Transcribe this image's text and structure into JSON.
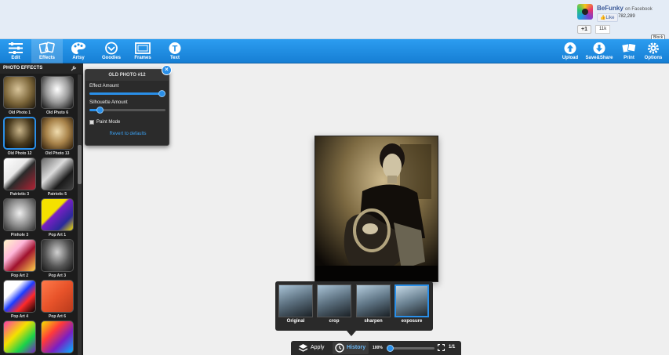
{
  "banner": {
    "brand": "BeFunky",
    "brand_sub": "on Facebook",
    "like_label": "Like",
    "like_count": "782,289",
    "gplus_label": "+1",
    "gplus_count": "11k",
    "block_tip": "Block"
  },
  "toolbar": {
    "left": [
      {
        "id": "edit",
        "label": "Edit",
        "icon": "sliders-icon"
      },
      {
        "id": "effects",
        "label": "Effects",
        "icon": "effects-icon",
        "active": true
      },
      {
        "id": "artsy",
        "label": "Artsy",
        "icon": "palette-icon"
      },
      {
        "id": "goodies",
        "label": "Goodies",
        "icon": "goodies-icon"
      },
      {
        "id": "frames",
        "label": "Frames",
        "icon": "frame-icon"
      },
      {
        "id": "text",
        "label": "Text",
        "icon": "text-icon"
      }
    ],
    "right": [
      {
        "id": "upload",
        "label": "Upload",
        "icon": "upload-icon"
      },
      {
        "id": "saveshare",
        "label": "Save&Share",
        "icon": "download-icon"
      },
      {
        "id": "print",
        "label": "Print",
        "icon": "print-icon"
      },
      {
        "id": "options",
        "label": "Options",
        "icon": "gear-icon"
      }
    ]
  },
  "sidebar": {
    "title": "PHOTO EFFECTS",
    "selected": "Old Photo 12",
    "thumbnails": [
      "Old Photo 1",
      "Old Photo 6",
      "Old Photo 12",
      "Old Photo 13",
      "Patriotic 3",
      "Patriotic 5",
      "Pinhole 3",
      "Pop Art 1",
      "Pop Art 2",
      "Pop Art 3",
      "Pop Art 4",
      "Pop Art 6",
      "",
      ""
    ]
  },
  "effect_panel": {
    "title": "OLD PHOTO #12",
    "effect_amount_label": "Effect Amount",
    "effect_amount": 0.95,
    "silhouette_label": "Silhouette Amount",
    "silhouette_amount": 0.13,
    "paint_mode_label": "Paint Mode",
    "paint_mode": false,
    "revert_label": "Revert to defaults",
    "close_label": "×"
  },
  "history": {
    "items": [
      {
        "label": "Original"
      },
      {
        "label": "crop"
      },
      {
        "label": "sharpen"
      },
      {
        "label": "exposure",
        "selected": true
      }
    ]
  },
  "bottom_bar": {
    "apply_label": "Apply",
    "history_label": "History",
    "zoom_label": "100%",
    "zoom_level": 0.05,
    "page_label": "1/1"
  },
  "colors": {
    "toolbar_blue": "#1f8fe6",
    "accent_blue": "#2a8fe8",
    "panel_dark": "#2b2b2b",
    "sidebar_dark": "#1c1c1c"
  }
}
